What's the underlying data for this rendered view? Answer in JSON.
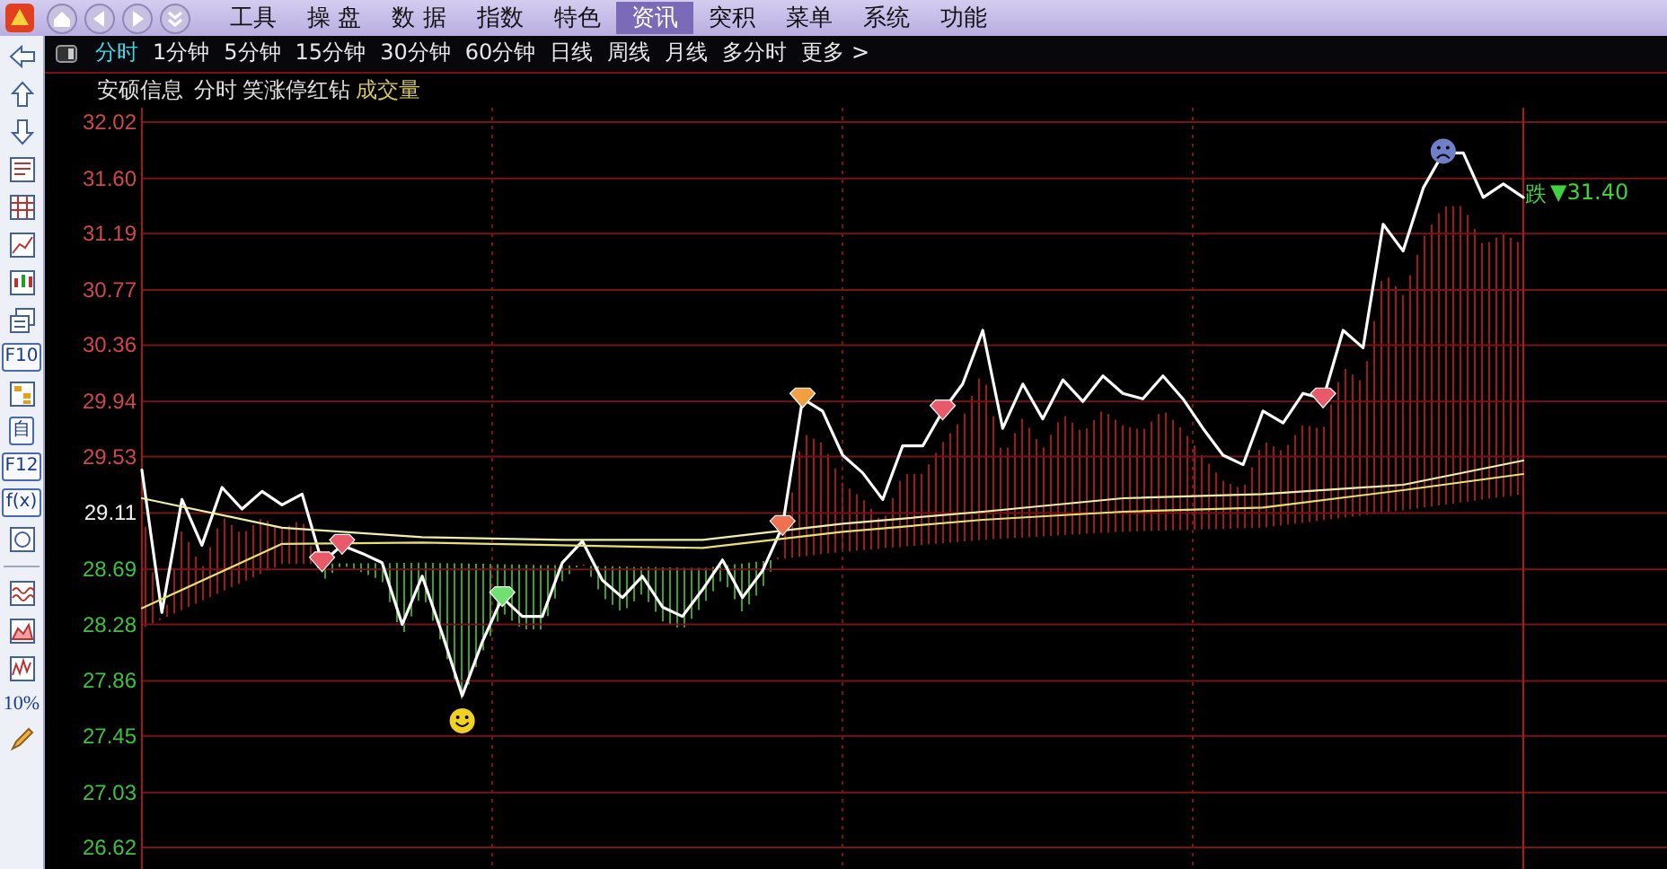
{
  "menu_bar": {
    "items": [
      {
        "label": "工具",
        "selected": false
      },
      {
        "label": "操 盘",
        "selected": false
      },
      {
        "label": "数 据",
        "selected": false
      },
      {
        "label": "指数",
        "selected": false
      },
      {
        "label": "特色",
        "selected": false
      },
      {
        "label": "资讯",
        "selected": true
      },
      {
        "label": "突积",
        "selected": false
      },
      {
        "label": "菜单",
        "selected": false
      },
      {
        "label": "系统",
        "selected": false
      },
      {
        "label": "功能",
        "selected": false
      }
    ]
  },
  "toolbar": [
    {
      "kind": "left"
    },
    {
      "kind": "up"
    },
    {
      "kind": "down"
    },
    {
      "kind": "report"
    },
    {
      "kind": "table"
    },
    {
      "kind": "line"
    },
    {
      "kind": "candle"
    },
    {
      "kind": "windows"
    },
    {
      "kind": "text",
      "label": "F10"
    },
    {
      "kind": "tree"
    },
    {
      "kind": "text",
      "label": "自"
    },
    {
      "kind": "text",
      "label": "F12"
    },
    {
      "kind": "text",
      "label": "f(x)"
    },
    {
      "kind": "circle"
    },
    {
      "kind": "separator"
    },
    {
      "kind": "wave"
    },
    {
      "kind": "mountain"
    },
    {
      "kind": "bars"
    },
    {
      "kind": "text",
      "label": "10%"
    },
    {
      "kind": "pencil"
    }
  ],
  "period_tabs": [
    {
      "label": "分时",
      "selected": true
    },
    {
      "label": "1分钟",
      "selected": false
    },
    {
      "label": "5分钟",
      "selected": false
    },
    {
      "label": "15分钟",
      "selected": false
    },
    {
      "label": "30分钟",
      "selected": false
    },
    {
      "label": "60分钟",
      "selected": false
    },
    {
      "label": "日线",
      "selected": false
    },
    {
      "label": "周线",
      "selected": false
    },
    {
      "label": "月线",
      "selected": false
    },
    {
      "label": "多分时",
      "selected": false
    },
    {
      "label": "更多 >",
      "selected": false
    }
  ],
  "chart_header": {
    "stock": "安硕信息",
    "view": "分时",
    "indicator": "笑涨停红钻",
    "volume": "成交量"
  },
  "last_price": {
    "direction": "跌",
    "arrow": "▼",
    "value": "31.40"
  },
  "chart_data": {
    "type": "line",
    "grid": true,
    "ylim": [
      26.62,
      32.02
    ],
    "yticks": [
      32.02,
      {
        "value": 31.6,
        "label": "31.60"
      },
      31.19,
      30.77,
      30.36,
      29.94,
      29.53,
      29.11,
      28.69,
      28.28,
      27.86,
      27.45,
      27.03,
      26.62
    ],
    "series": [
      {
        "color": "#ffffff",
        "values": [
          29.43,
          28.37,
          29.21,
          28.87,
          29.3,
          29.14,
          29.27,
          29.17,
          29.25,
          28.74,
          28.87,
          28.81,
          28.74,
          28.28,
          28.64,
          28.21,
          27.75,
          28.15,
          28.48,
          28.34,
          28.34,
          28.74,
          28.9,
          28.61,
          28.48,
          28.64,
          28.41,
          28.34,
          28.54,
          28.76,
          28.48,
          28.68,
          29.01,
          29.96,
          29.87,
          29.54,
          29.41,
          29.21,
          29.61,
          29.61,
          29.87,
          30.07,
          30.47,
          29.74,
          30.07,
          29.81,
          30.1,
          29.94,
          30.13,
          30.0,
          29.96,
          30.13,
          29.96,
          29.74,
          29.54,
          29.47,
          29.87,
          29.78,
          30.0,
          29.96,
          30.47,
          30.34,
          31.26,
          31.06,
          31.53,
          31.79,
          31.79,
          31.46,
          31.56,
          31.46
        ]
      },
      {
        "color": "#f0f0a8",
        "values": [
          29.22,
          null,
          null,
          null,
          null,
          null,
          null,
          29.0,
          null,
          null,
          null,
          null,
          null,
          null,
          28.93,
          null,
          null,
          null,
          null,
          null,
          null,
          28.91,
          null,
          null,
          null,
          null,
          null,
          null,
          28.91,
          null,
          null,
          null,
          null,
          null,
          null,
          29.03,
          null,
          null,
          null,
          null,
          null,
          null,
          29.12,
          null,
          null,
          null,
          null,
          null,
          null,
          29.22,
          null,
          null,
          null,
          null,
          null,
          null,
          29.25,
          null,
          null,
          null,
          null,
          null,
          null,
          29.32,
          null,
          null,
          null,
          null,
          null,
          29.5
        ]
      },
      {
        "color": "#e8e070",
        "values": [
          28.4,
          null,
          null,
          null,
          null,
          null,
          null,
          28.88,
          null,
          null,
          null,
          null,
          null,
          null,
          28.89,
          null,
          null,
          null,
          null,
          null,
          null,
          28.87,
          null,
          null,
          null,
          null,
          null,
          null,
          28.85,
          null,
          null,
          null,
          null,
          null,
          null,
          28.97,
          null,
          null,
          null,
          null,
          null,
          null,
          29.06,
          null,
          null,
          null,
          null,
          null,
          null,
          29.12,
          null,
          null,
          null,
          null,
          null,
          null,
          29.15,
          null,
          null,
          null,
          null,
          null,
          null,
          29.28,
          null,
          null,
          null,
          null,
          null,
          29.4
        ]
      }
    ]
  }
}
